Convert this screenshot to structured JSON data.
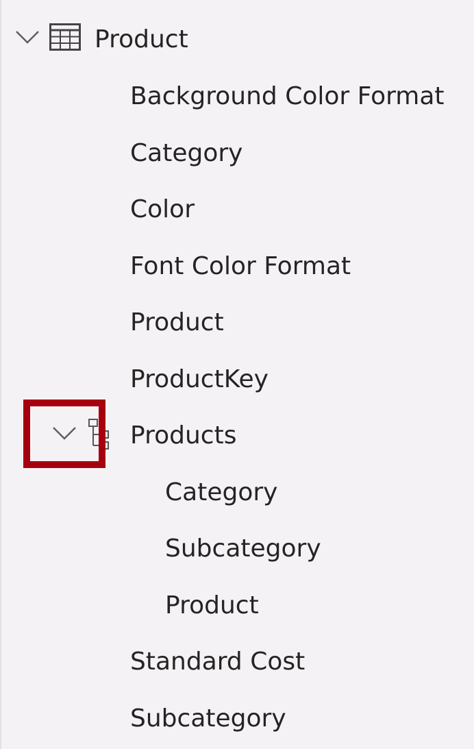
{
  "tree": {
    "table": {
      "label": "Product",
      "icon": "table-icon",
      "expanded": true
    },
    "fields": {
      "background_color_format": "Background Color Format",
      "category": "Category",
      "color": "Color",
      "font_color_format": "Font Color Format",
      "product": "Product",
      "product_key": "ProductKey",
      "standard_cost": "Standard Cost",
      "subcategory": "Subcategory"
    },
    "hierarchy": {
      "label": "Products",
      "icon": "hierarchy-icon",
      "expanded": true,
      "levels": [
        "Category",
        "Subcategory",
        "Product"
      ]
    }
  },
  "colors": {
    "highlight": "#a6000f",
    "background": "#f5f2f6",
    "text": "#252423"
  }
}
